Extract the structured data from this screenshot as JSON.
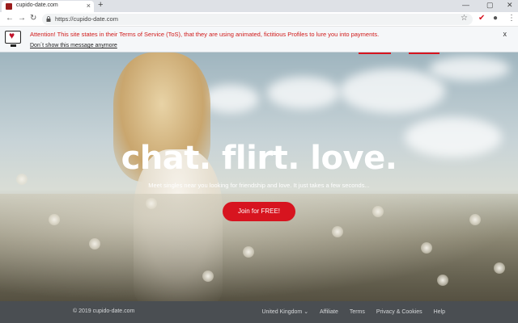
{
  "browser": {
    "tab_title": "cupido-date.com",
    "url": "https://cupido-date.com",
    "new_tab": "+",
    "tab_close": "×",
    "window_controls": [
      "—",
      "▢",
      "✕"
    ]
  },
  "notice": {
    "message": "Attention! This site states in their Terms of Service (ToS), that they are using animated, fictitious Profiles to lure you into payments.",
    "dismiss": "Don´t show this message anymore",
    "close": "x"
  },
  "hero": {
    "headline": "chat. flirt. love.",
    "subline": "Meet singles near you looking for friendship and love. It just takes a few seconds...",
    "cta": "Join for FREE!"
  },
  "footer": {
    "copyright": "© 2019 cupido-date.com",
    "country": "United Kingdom",
    "links": [
      "Affiliate",
      "Terms",
      "Privacy & Cookies",
      "Help"
    ]
  },
  "colors": {
    "accent": "#d7141f",
    "notice_text": "#d01a1a",
    "footer_bg": "#4a4e52"
  }
}
